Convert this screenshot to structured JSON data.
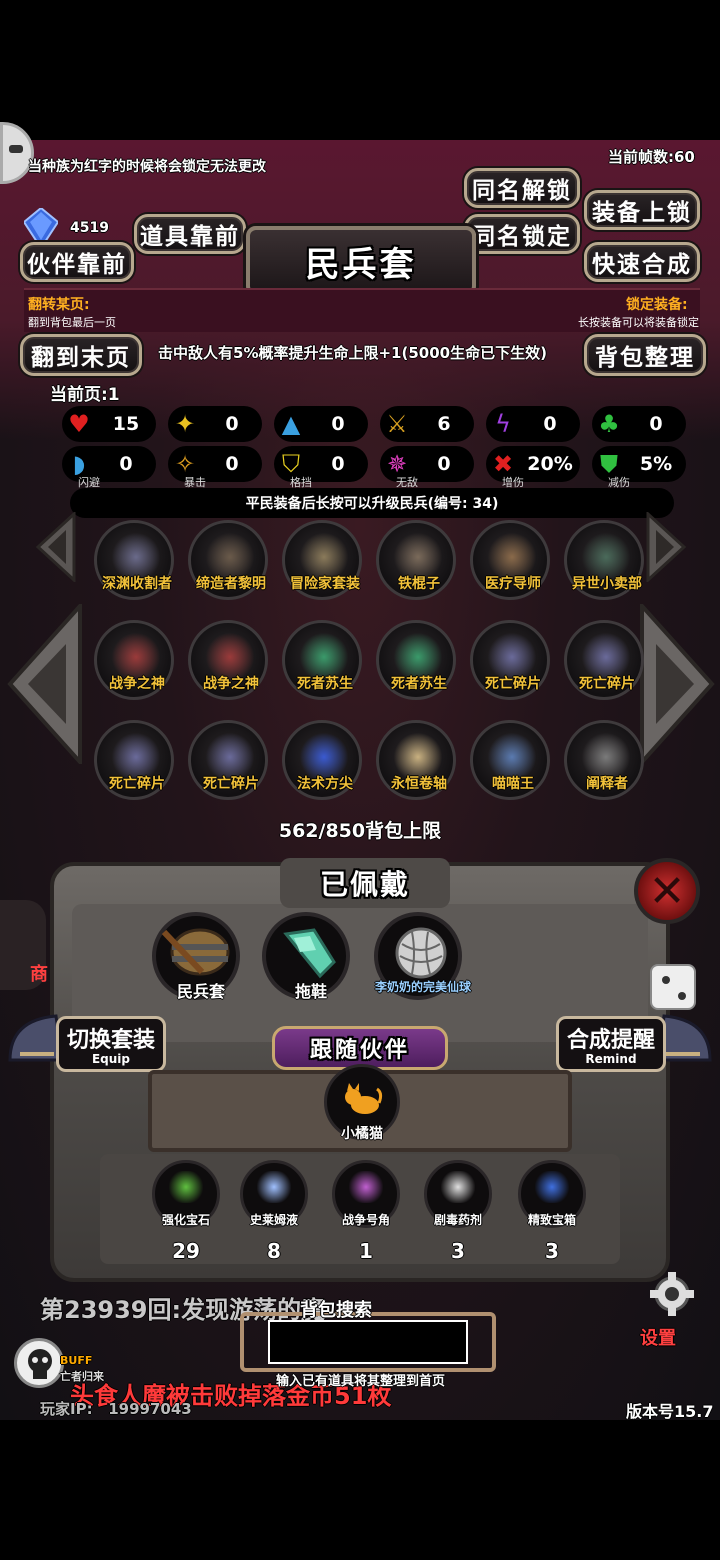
{
  "top_notice": "当种族为红字的时候将会锁定无法更改",
  "fps": "当前帧数:60",
  "resource_count": "4519",
  "title": "民兵套",
  "buttons": {
    "item_forward": "道具靠前",
    "partner_forward": "伙伴靠前",
    "same_name_unlock": "同名解锁",
    "same_name_lock": "同名锁定",
    "equip_lock": "装备上锁",
    "quick_synthesize": "快速合成",
    "go_last_page": "翻到末页",
    "organize_bag": "背包整理"
  },
  "info": {
    "flip_label": "翻转某页:",
    "flip_sub": "翻到背包最后一页",
    "lock_label": "锁定装备:",
    "lock_sub": "长按装备可以将装备锁定"
  },
  "set_effect": "击中敌人有5%概率提升生命上限+1(5000生命已下生效)",
  "current_page": "当前页:1",
  "stats_row1": [
    {
      "icon": "heart-icon",
      "value": "15",
      "color": "#e02020"
    },
    {
      "icon": "strength-icon",
      "value": "0",
      "color": "#e8c020"
    },
    {
      "icon": "helmet-icon",
      "value": "0",
      "color": "#3aa0e0"
    },
    {
      "icon": "sword-icon",
      "value": "6",
      "color": "#d8a020"
    },
    {
      "icon": "lightning-icon",
      "value": "0",
      "color": "#a040e0"
    },
    {
      "icon": "clover-icon",
      "value": "0",
      "color": "#30c040"
    }
  ],
  "stats_row2": [
    {
      "icon": "dodge-icon",
      "value": "0",
      "sub": "闪避",
      "color": "#3aa0e0"
    },
    {
      "icon": "crit-icon",
      "value": "0",
      "sub": "暴击",
      "color": "#e0a020"
    },
    {
      "icon": "block-icon",
      "value": "0",
      "sub": "格挡",
      "color": "#e8d020"
    },
    {
      "icon": "invincible-icon",
      "value": "0",
      "sub": "无敌",
      "color": "#e040c0"
    },
    {
      "icon": "damage-up-icon",
      "value": "20%",
      "sub": "增伤",
      "color": "#e02020"
    },
    {
      "icon": "damage-down-icon",
      "value": "5%",
      "sub": "减伤",
      "color": "#30c040"
    }
  ],
  "upgrade_hint": "平民装备后长按可以升级民兵(编号:  34)",
  "inventory": [
    [
      "深渊收割者",
      "缔造者黎明",
      "冒险家套装",
      "铁棍子",
      "医疗导师",
      "异世小卖部"
    ],
    [
      "战争之神",
      "战争之神",
      "死者苏生",
      "死者苏生",
      "死亡碎片",
      "死亡碎片"
    ],
    [
      "死亡碎片",
      "死亡碎片",
      "法术方尖",
      "永恒卷轴",
      "喵喵王",
      "阐释者"
    ]
  ],
  "capacity": "562/850背包上限",
  "worn": {
    "title": "已佩戴",
    "slots": [
      "民兵套",
      "拖鞋",
      "李奶奶的完美仙球"
    ]
  },
  "switch_set": {
    "main": "切换套装",
    "sub": "Equip"
  },
  "synth_remind": {
    "main": "合成提醒",
    "sub": "Remind"
  },
  "companion": {
    "title": "跟随伙伴",
    "pet": "小橘猫"
  },
  "materials": [
    {
      "name": "强化宝石",
      "count": "29"
    },
    {
      "name": "史莱姆液",
      "count": "8"
    },
    {
      "name": "战争号角",
      "count": "1"
    },
    {
      "name": "剧毒药剂",
      "count": "3"
    },
    {
      "name": "精致宝箱",
      "count": "3"
    }
  ],
  "search": {
    "label": "背包搜索",
    "hint": "输入已有道具将其整理到首页",
    "value": ""
  },
  "bg_log1": "第23939回:发现游荡的魔",
  "bg_log2": "头食人魔被击败掉落金币51枚",
  "buff": {
    "label": "BUFF",
    "sub": "亡者归来"
  },
  "player_ip_label": "玩家IP:",
  "player_ip": "19997043",
  "version": "版本号15.7",
  "settings": "设置",
  "shop_label": "商"
}
